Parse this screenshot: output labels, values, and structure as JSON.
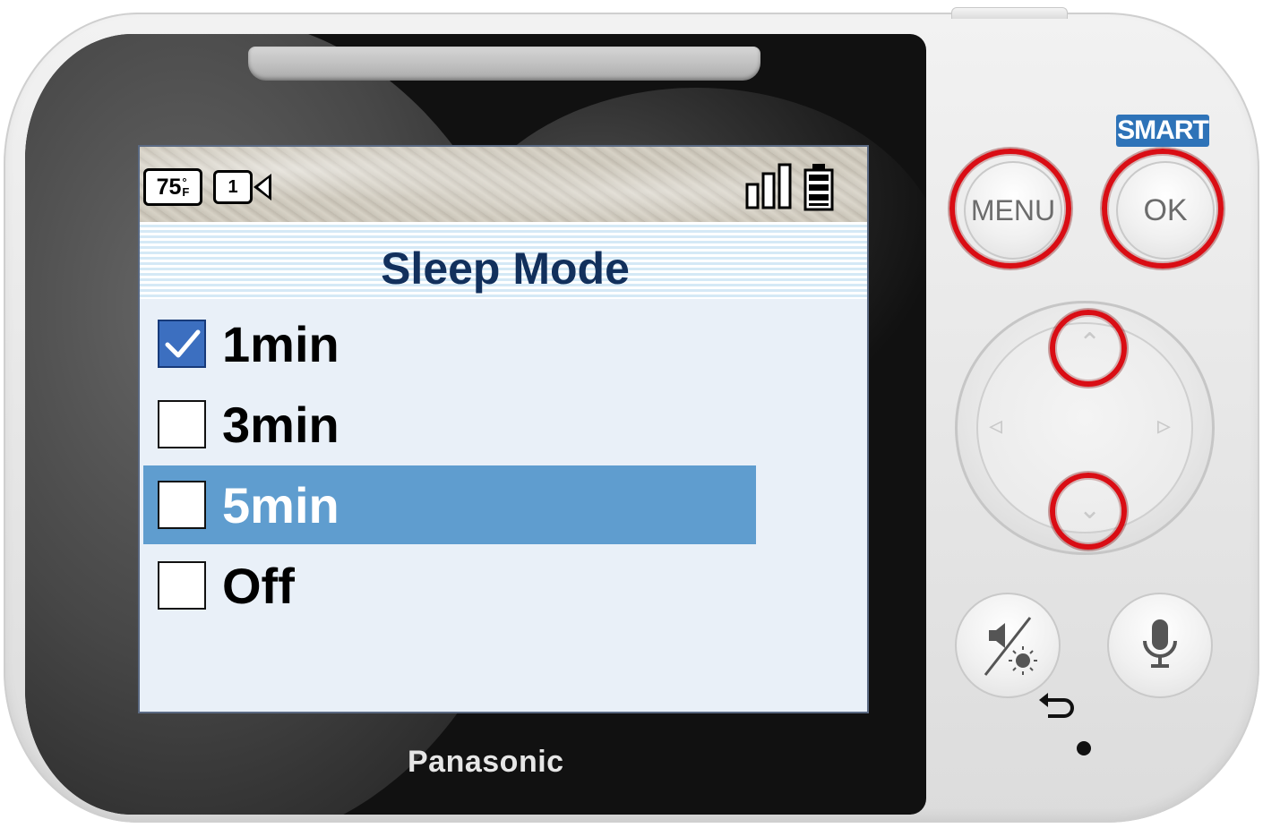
{
  "device": {
    "brand": "Panasonic"
  },
  "status_bar": {
    "temperature_value": "75",
    "temperature_degree": "°",
    "temperature_unit": "F",
    "camera_number": "1",
    "camera_icon": "video-camera-icon",
    "signal_icon": "signal-strength-icon",
    "battery_icon": "battery-full-icon"
  },
  "screen": {
    "title": "Sleep Mode",
    "options": [
      {
        "label": "1min",
        "checked": true,
        "highlighted": false
      },
      {
        "label": "3min",
        "checked": false,
        "highlighted": false
      },
      {
        "label": "5min",
        "checked": false,
        "highlighted": true
      },
      {
        "label": "Off",
        "checked": false,
        "highlighted": false
      }
    ]
  },
  "controls": {
    "smart_label": "SMART",
    "menu_label": "MENU",
    "ok_label": "OK",
    "up_icon": "chevron-up-icon",
    "down_icon": "chevron-down-icon",
    "left_icon": "chevron-left-icon",
    "right_icon": "chevron-right-icon",
    "mute_brightness_icon": "mute-brightness-icon",
    "back_icon": "back-arrow-icon",
    "talk_icon": "microphone-icon"
  },
  "colors": {
    "highlight_ring": "#d90d14",
    "selection_bar": "#5f9dcf",
    "title_text": "#12305c",
    "smart_badge": "#2e73b8",
    "checked_box": "#3c6fc0"
  }
}
